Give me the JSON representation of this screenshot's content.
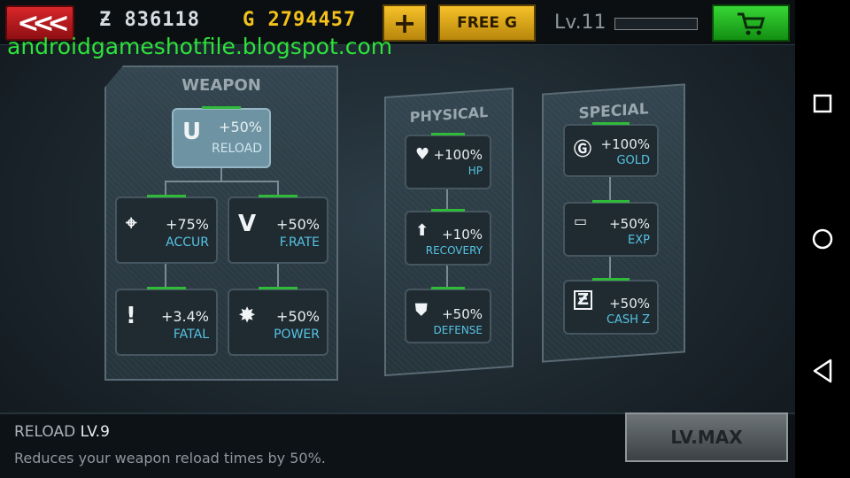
{
  "header": {
    "back_icon": "double-chevron-left-icon",
    "zcash_prefix": "Ƶ",
    "zcash": "836118",
    "gold_prefix": "G",
    "gold": "2794457",
    "plus_label": "+",
    "free_label": "FREE  G",
    "level": "Lv.11",
    "xp_fraction": 0.0,
    "cart_icon": "cart-icon"
  },
  "watermark": "androidgameshotfile.blogspot.com",
  "weapon": {
    "title": "WEAPON",
    "nodes": [
      {
        "value": "+50%",
        "label": "RELOAD",
        "icon": "magnet-icon"
      },
      {
        "value": "+75%",
        "label": "ACCUR",
        "icon": "crosshair-icon"
      },
      {
        "value": "+50%",
        "label": "F.RATE",
        "icon": "v-icon"
      },
      {
        "value": "+3.4%",
        "label": "FATAL",
        "icon": "exclamation-icon"
      },
      {
        "value": "+50%",
        "label": "POWER",
        "icon": "burst-icon"
      }
    ]
  },
  "physical": {
    "title": "PHYSICAL",
    "nodes": [
      {
        "value": "+100%",
        "label": "HP",
        "icon": "heart-icon"
      },
      {
        "value": "+10%",
        "label": "RECOVERY",
        "icon": "up-arrow-icon"
      },
      {
        "value": "+50%",
        "label": "DEFENSE",
        "icon": "shield-icon"
      }
    ]
  },
  "special": {
    "title": "SPECIAL",
    "nodes": [
      {
        "value": "+100%",
        "label": "GOLD",
        "icon": "gold-coin-icon"
      },
      {
        "value": "+50%",
        "label": "EXP",
        "icon": "exp-icon"
      },
      {
        "value": "+50%",
        "label": "CASH Z",
        "icon": "cash-z-icon"
      }
    ]
  },
  "footer": {
    "skill_name": "RELOAD",
    "skill_level": "LV.9",
    "description": "Reduces your weapon reload times by 50%.",
    "button_label": "LV.MAX"
  },
  "navbar": {
    "recent_icon": "recent-apps-icon",
    "home_icon": "home-icon",
    "back_icon": "back-icon"
  },
  "colors": {
    "accent_green": "#2fba3a",
    "gold": "#f4c21a",
    "label_blue": "#57c3e4"
  }
}
